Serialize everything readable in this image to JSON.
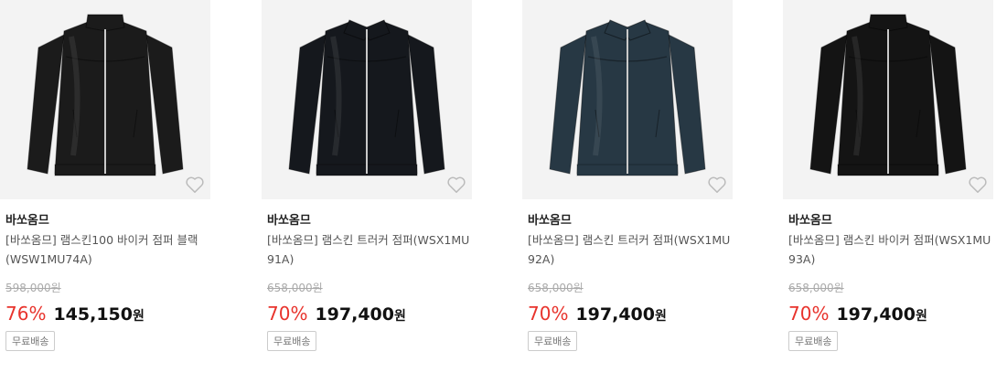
{
  "products": [
    {
      "brand": "바쏘옴므",
      "name": "[바쏘옴므] 램스킨100 바이커 점퍼 블랙 (WSW1MU74A)",
      "original_price": "598,000원",
      "discount_rate": "76%",
      "sale_price": "145,150",
      "currency": "원",
      "badge": "무료배송",
      "jacket_color": "#1b1b1b",
      "collar": "stand"
    },
    {
      "brand": "바쏘옴므",
      "name": "[바쏘옴므] 램스킨 트러커 점퍼(WSX1MU91A)",
      "original_price": "658,000원",
      "discount_rate": "70%",
      "sale_price": "197,400",
      "currency": "원",
      "badge": "무료배송",
      "jacket_color": "#15181d",
      "collar": "shirt"
    },
    {
      "brand": "바쏘옴므",
      "name": "[바쏘옴므] 램스킨 트러커 점퍼(WSX1MU92A)",
      "original_price": "658,000원",
      "discount_rate": "70%",
      "sale_price": "197,400",
      "currency": "원",
      "badge": "무료배송",
      "jacket_color": "#273844",
      "collar": "shirt"
    },
    {
      "brand": "바쏘옴므",
      "name": "[바쏘옴므] 램스킨 바이커 점퍼(WSX1MU93A)",
      "original_price": "658,000원",
      "discount_rate": "70%",
      "sale_price": "197,400",
      "currency": "원",
      "badge": "무료배송",
      "jacket_color": "#141414",
      "collar": "stand"
    }
  ],
  "icons": {
    "wishlist": "heart-icon"
  },
  "colors": {
    "discount": "#e8332c"
  }
}
